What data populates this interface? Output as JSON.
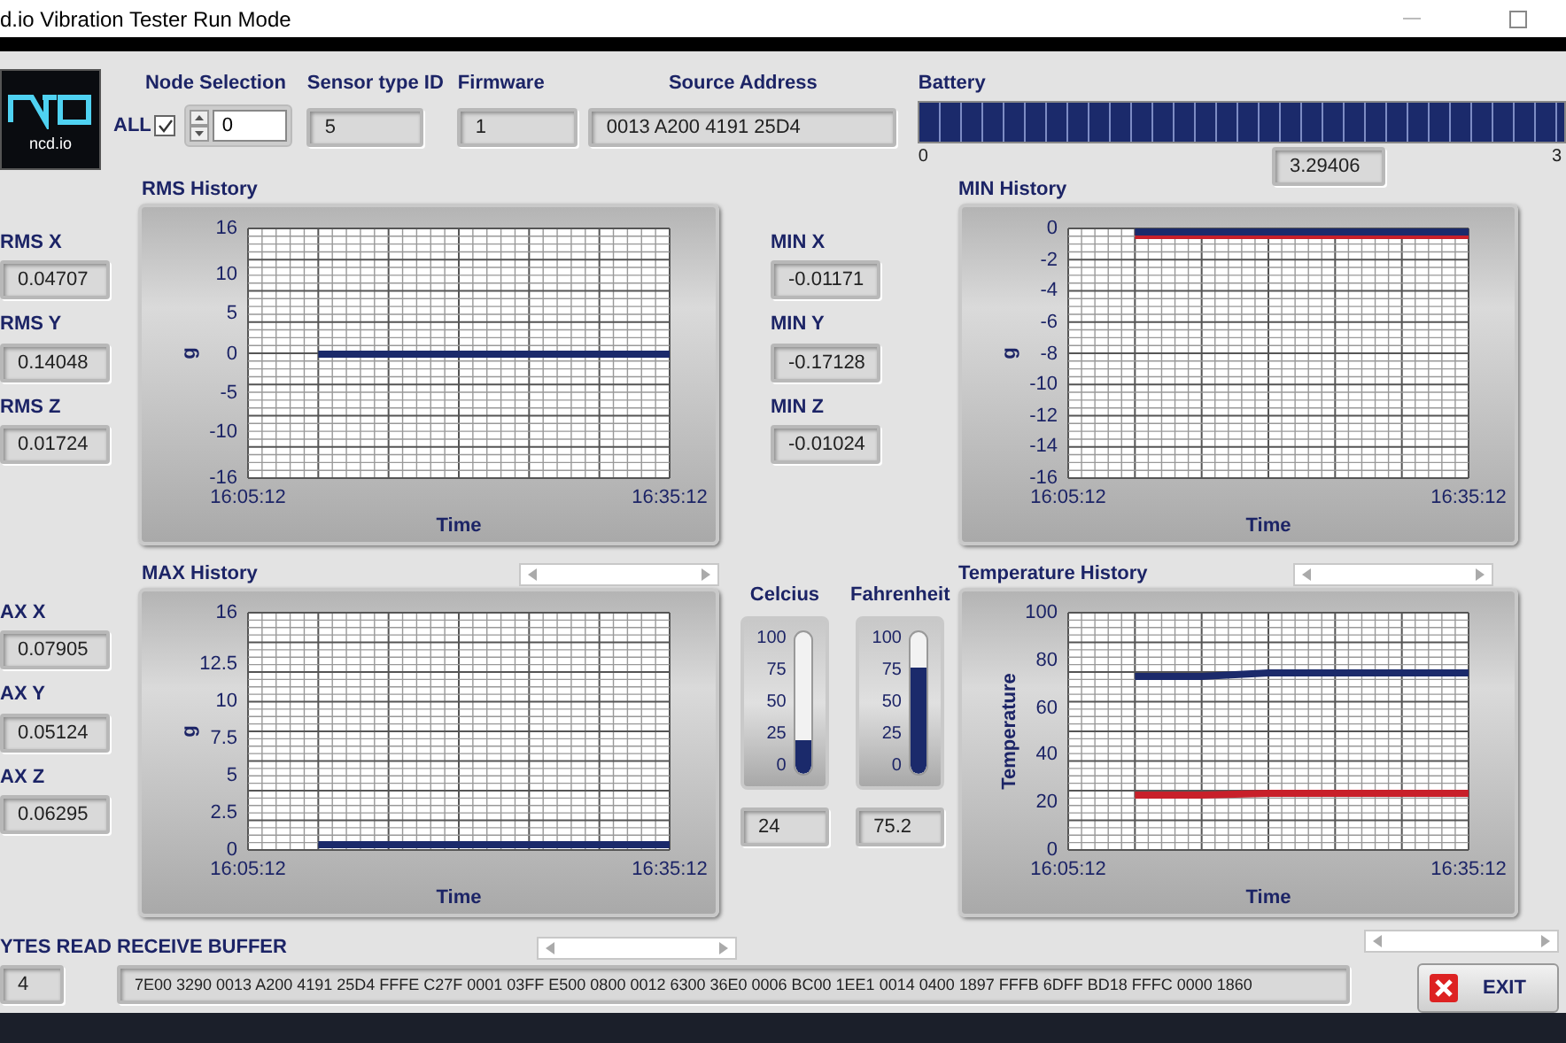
{
  "window": {
    "title": "d.io Vibration Tester Run Mode"
  },
  "logo": {
    "text": "ncd.io"
  },
  "node_selection": {
    "label": "Node Selection",
    "all_label": "ALL",
    "all_checked": true,
    "value": "0"
  },
  "sensor_type": {
    "label": "Sensor type ID",
    "value": "5"
  },
  "firmware": {
    "label": "Firmware",
    "value": "1"
  },
  "source_address": {
    "label": "Source Address",
    "value": "0013 A200 4191 25D4"
  },
  "battery": {
    "label": "Battery",
    "level": 1,
    "scale_min": "0",
    "scale_max": "3",
    "reading": "3.29406"
  },
  "rms": {
    "title": "RMS History",
    "readouts": [
      {
        "label": "RMS X",
        "value": "0.04707"
      },
      {
        "label": "RMS Y",
        "value": "0.14048"
      },
      {
        "label": "RMS Z",
        "value": "0.01724"
      }
    ],
    "chart_data": {
      "type": "line",
      "grid": true,
      "xlabel": "Time",
      "ylabel": "g",
      "ylim": [
        -16,
        16
      ],
      "yticks": [
        -16,
        -10,
        -5,
        0,
        5,
        10,
        16
      ],
      "categories": [
        "16:05:12",
        null,
        null,
        null,
        null,
        null,
        "16:35:12"
      ],
      "series": [
        {
          "color": "#1b2a6b",
          "values": [
            null,
            0,
            0,
            0,
            0,
            0,
            0
          ]
        }
      ]
    }
  },
  "min": {
    "title": "MIN History",
    "readouts": [
      {
        "label": "MIN  X",
        "value": "-0.01171"
      },
      {
        "label": "MIN  Y",
        "value": "-0.17128"
      },
      {
        "label": "MIN  Z",
        "value": "-0.01024"
      }
    ],
    "chart_data": {
      "type": "line",
      "grid": true,
      "xlabel": "Time",
      "ylabel": "g",
      "ylim": [
        -16,
        0
      ],
      "yticks": [
        -16,
        -14,
        -12,
        -10,
        -8,
        -6,
        -4,
        -2,
        0
      ],
      "categories": [
        "16:05:12",
        null,
        null,
        null,
        null,
        null,
        "16:35:12"
      ],
      "series": [
        {
          "color": "#c8202a",
          "values": [
            null,
            -0.5,
            -0.5,
            -0.5,
            -0.5,
            -0.5,
            -0.5
          ]
        },
        {
          "color": "#1b2a6b",
          "values": [
            null,
            -0.2,
            -0.2,
            -0.2,
            -0.2,
            -0.2,
            -0.2
          ]
        }
      ]
    }
  },
  "max": {
    "title": "MAX History",
    "readouts": [
      {
        "label": "AX X",
        "value": "0.07905"
      },
      {
        "label": "AX Y",
        "value": "0.05124"
      },
      {
        "label": "AX Z",
        "value": "0.06295"
      }
    ],
    "chart_data": {
      "type": "line",
      "grid": true,
      "xlabel": "Time",
      "ylabel": "g",
      "ylim": [
        0,
        16
      ],
      "yticks": [
        0,
        2.5,
        5,
        7.5,
        10,
        12.5,
        16
      ],
      "categories": [
        "16:05:12",
        null,
        null,
        null,
        null,
        null,
        "16:35:12"
      ],
      "series": [
        {
          "color": "#1b2a6b",
          "values": [
            null,
            0.3,
            0.3,
            0.3,
            0.3,
            0.3,
            0.3
          ]
        }
      ]
    }
  },
  "thermometers": [
    {
      "label": "Celcius",
      "level": 0.24,
      "ticks": [
        "100",
        "75",
        "50",
        "25",
        "0"
      ],
      "value": "24"
    },
    {
      "label": "Fahrenheit",
      "level": 0.752,
      "ticks": [
        "100",
        "75",
        "50",
        "25",
        "0"
      ],
      "value": "75.2"
    }
  ],
  "temperature": {
    "title": "Temperature History",
    "chart_data": {
      "type": "line",
      "grid": true,
      "xlabel": "Time",
      "ylabel": "Temperature",
      "ylim": [
        0,
        100
      ],
      "yticks": [
        0,
        20,
        40,
        60,
        80,
        100
      ],
      "categories": [
        "16:05:12",
        null,
        null,
        null,
        null,
        null,
        "16:35:12"
      ],
      "series": [
        {
          "color": "#1b2a6b",
          "values": [
            null,
            73,
            73,
            75,
            75,
            75,
            75
          ]
        },
        {
          "color": "#c8202a",
          "values": [
            null,
            23,
            23,
            24,
            24,
            24,
            24
          ]
        }
      ]
    }
  },
  "bytes_read": {
    "label": "YTES READ",
    "value": "4"
  },
  "receive_buffer": {
    "label": "RECEIVE BUFFER",
    "value": "7E00 3290 0013 A200 4191 25D4 FFFE C27F 0001 03FF E500 0800 0012 6300 36E0 0006 BC00 1EE1 0014 0400 1897 FFFB 6DFF BD18 FFFC 0000 1860"
  },
  "exit_button": {
    "label": "EXIT"
  }
}
